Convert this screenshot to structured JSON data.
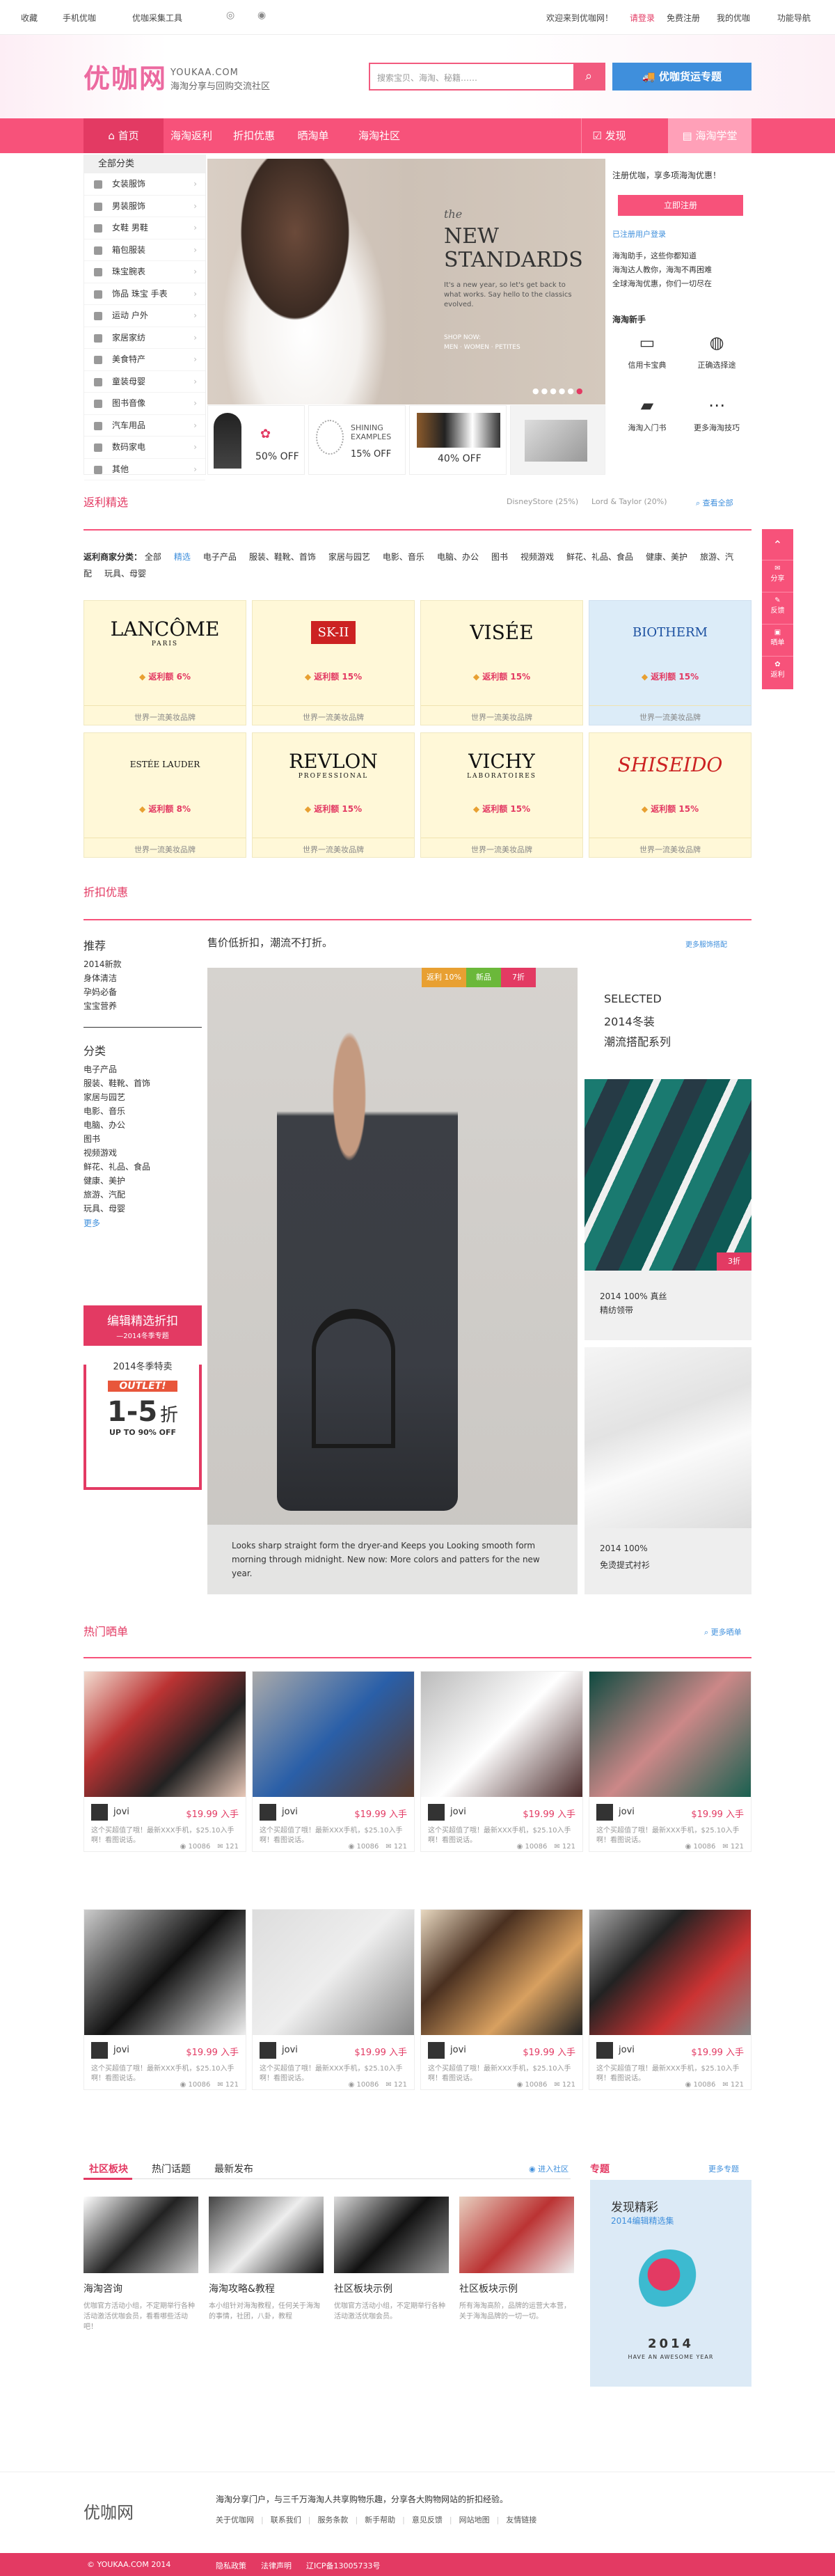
{
  "topbar": {
    "favorite": "收藏",
    "mobile": "手机优咖",
    "tool": "优咖采集工具",
    "welcome": "欢迎来到优咖网！",
    "login": "请登录",
    "register": "免费注册",
    "my_youka": "我的优咖",
    "nav": "功能导航"
  },
  "header": {
    "logo": "优咖网",
    "domain": "YOUKAA.COM",
    "slogan": "海淘分享与回购交流社区",
    "search_placeholder": "搜索宝贝、海淘、秘籍……",
    "promo": "优咖货运专题"
  },
  "nav": {
    "home": "首页",
    "items": [
      "海淘返利",
      "折扣优惠",
      "晒淘单",
      "海淘社区"
    ],
    "discover": "发现",
    "learn": "海淘学堂"
  },
  "categories": {
    "title": "全部分类",
    "items": [
      "女装服饰",
      "男装服饰",
      "女鞋 男鞋",
      "箱包服装",
      "珠宝腕表",
      "饰品 珠宝 手表",
      "运动 户外",
      "家居家纺",
      "美食特产",
      "童装母婴",
      "图书音像",
      "汽车用品",
      "数码家电",
      "其他"
    ]
  },
  "banner": {
    "script": "the",
    "headline": "NEW STANDARDS",
    "body": "It's a new year, so let's get back to what works. Say hello to the classics evolved.",
    "shop": "SHOP NOW:",
    "links": "MEN · WOMEN · PETITES"
  },
  "mini_cards": [
    {
      "label": "50% OFF"
    },
    {
      "label": "SHINING EXAMPLES",
      "sub": "15% OFF"
    },
    {
      "label": "40% OFF"
    }
  ],
  "right_panel": {
    "register_prompt": "注册优咖，享多项海淘优惠！",
    "register_btn": "立即注册",
    "login_link": "已注册用户登录",
    "links": [
      "海淘助手，这些你都知道",
      "海淘达人教你，海淘不再困难",
      "全球海淘优惠，你们一切尽在"
    ],
    "tools_title": "海淘新手",
    "tools": [
      "信用卡宝典",
      "正确选择途",
      "海淘入门书",
      "更多海淘技巧"
    ]
  },
  "rebate": {
    "title": "返利精选",
    "tabs": [
      "DisneyStore (25%)",
      "Lord & Taylor (20%)"
    ],
    "view_all": "查看全部",
    "filter_label": "返利商家分类：",
    "filters": [
      "全部",
      "精选",
      "电子产品",
      "服装、鞋靴、首饰",
      "家居与园艺",
      "电影、音乐",
      "电脑、办公",
      "图书",
      "视频游戏",
      "鲜花、礼品、食品",
      "健康、美护",
      "旅游、汽配",
      "玩具、母婴"
    ],
    "brands": [
      {
        "name": "LANCÔME",
        "sub": "PARIS",
        "rebate": "返利额 6%",
        "tag": "世界一流美妆品牌"
      },
      {
        "name": "SK-II",
        "rebate": "返利额 15%",
        "tag": "世界一流美妆品牌"
      },
      {
        "name": "VISÉE",
        "rebate": "返利额 15%",
        "tag": "世界一流美妆品牌"
      },
      {
        "name": "BIOTHERM",
        "rebate": "返利额 15%",
        "tag": "世界一流美妆品牌"
      },
      {
        "name": "ESTÉE LAUDER",
        "rebate": "返利额 8%",
        "tag": "世界一流美妆品牌"
      },
      {
        "name": "REVLON",
        "sub": "PROFESSIONAL",
        "rebate": "返利额 15%",
        "tag": "世界一流美妆品牌"
      },
      {
        "name": "VICHY",
        "sub": "LABORATOIRES",
        "rebate": "返利额 15%",
        "tag": "世界一流美妆品牌"
      },
      {
        "name": "SHISEIDO",
        "rebate": "返利额 15%",
        "tag": "世界一流美妆品牌"
      }
    ]
  },
  "discount": {
    "title": "折扣优惠",
    "recommend_title": "推荐",
    "recommend": [
      "2014新款",
      "身体清洁",
      "孕妈必备",
      "宝宝营养"
    ],
    "category_title": "分类",
    "categories": [
      "电子产品",
      "服装、鞋靴、首饰",
      "家居与园艺",
      "电影、音乐",
      "电脑、办公",
      "图书",
      "视频游戏",
      "鲜花、礼品、食品",
      "健康、美护",
      "旅游、汽配",
      "玩具、母婴"
    ],
    "more": "更多",
    "editor_btn": "编辑精选折扣",
    "editor_sub": "—2014冬季专题",
    "winter_title": "2014冬季特卖",
    "outlet": "OUTLET!",
    "off_big": "1-5",
    "off_unit": "折",
    "off_sub": "UP TO 90% OFF",
    "headline": "售价低折扣，潮流不打折。",
    "more_link": "更多服饰搭配",
    "tags": [
      "返利 10%",
      "新品",
      "7折"
    ],
    "caption": "Looks sharp straight form the dryer-and Keeps you Looking smooth form morning through midnight. New now: More colors and patters for the new year.",
    "selected": "SELECTED",
    "season": "2014冬装",
    "series": "潮流搭配系列",
    "tie_tag": "3折",
    "tie_title": "2014 100% 真丝",
    "tie_sub": "精纺领带",
    "shirt_title": "2014 100%",
    "shirt_sub": "免烫提式衬衫"
  },
  "hot": {
    "title": "热门晒单",
    "more": "更多晒单",
    "cards": [
      {
        "user": "jovi",
        "price": "$19.99 入手",
        "desc": "这个买超值了哦！最新XXX手机，$25.10入手啊！看图说话。",
        "views": "10086",
        "comments": "121"
      },
      {
        "user": "jovi",
        "price": "$19.99 入手",
        "desc": "这个买超值了哦！最新XXX手机，$25.10入手啊！看图说话。",
        "views": "10086",
        "comments": "121"
      },
      {
        "user": "jovi",
        "price": "$19.99 入手",
        "desc": "这个买超值了哦！最新XXX手机，$25.10入手啊！看图说话。",
        "views": "10086",
        "comments": "121"
      },
      {
        "user": "jovi",
        "price": "$19.99 入手",
        "desc": "这个买超值了哦！最新XXX手机，$25.10入手啊！看图说话。",
        "views": "10086",
        "comments": "121"
      },
      {
        "user": "jovi",
        "price": "$19.99 入手",
        "desc": "这个买超值了哦！最新XXX手机，$25.10入手啊！看图说话。",
        "views": "10086",
        "comments": "121"
      },
      {
        "user": "jovi",
        "price": "$19.99 入手",
        "desc": "这个买超值了哦！最新XXX手机，$25.10入手啊！看图说话。",
        "views": "10086",
        "comments": "121"
      },
      {
        "user": "jovi",
        "price": "$19.99 入手",
        "desc": "这个买超值了哦！最新XXX手机，$25.10入手啊！看图说话。",
        "views": "10086",
        "comments": "121"
      },
      {
        "user": "jovi",
        "price": "$19.99 入手",
        "desc": "这个买超值了哦！最新XXX手机，$25.10入手啊！看图说话。",
        "views": "10086",
        "comments": "121"
      }
    ]
  },
  "community": {
    "tabs": [
      "社区板块",
      "热门话题",
      "最新发布"
    ],
    "enter": "进入社区",
    "posts": [
      {
        "title": "海淘咨询",
        "desc": "优咖官方活动小组，不定期举行各种活动激活优咖会员，看看哪些活动吧！"
      },
      {
        "title": "海淘攻略&教程",
        "desc": "本小组针对海淘教程，任何关于海淘的事情，社团，八卦，教程"
      },
      {
        "title": "社区板块示例",
        "desc": "优咖官方活动小组，不定期举行各种活动激活优咖会员。"
      },
      {
        "title": "社区板块示例",
        "desc": "所有海淘高阶，品牌的运营大本营，关于海淘品牌的一切一切。"
      }
    ],
    "special_title": "专题",
    "special_more": "更多专题",
    "special_head": "发现精彩",
    "special_sub": "2014编辑精选集",
    "special_year": "2014",
    "special_tag": "HAVE AN AWESOME YEAR"
  },
  "footer": {
    "logo": "优咖网",
    "desc": "海淘分享门户，与三千万海淘人共享购物乐趣，分享各大购物网站的折扣经验。",
    "links": [
      "关于优咖网",
      "联系我们",
      "服务条款",
      "新手帮助",
      "意见反馈",
      "网站地图",
      "友情链接"
    ],
    "copyright": "© YOUKAA.COM 2014",
    "b1": "隐私政策",
    "b2": "法律声明",
    "icp": "辽ICP备13005733号"
  },
  "floatbar": [
    "分享",
    "反馈",
    "晒单",
    "返利"
  ]
}
